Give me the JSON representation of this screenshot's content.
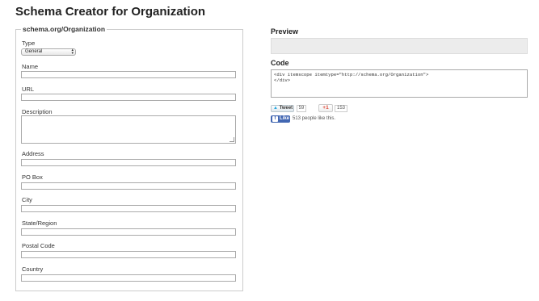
{
  "header": {
    "title": "Schema Creator for Organization"
  },
  "form": {
    "legend": "schema.org/Organization",
    "type_label": "Type",
    "type_value": "General",
    "fields": [
      {
        "label": "Name"
      },
      {
        "label": "URL"
      },
      {
        "label": "Description"
      },
      {
        "label": "Address"
      },
      {
        "label": "PO Box"
      },
      {
        "label": "City"
      },
      {
        "label": "State/Region"
      },
      {
        "label": "Postal Code"
      },
      {
        "label": "Country"
      }
    ]
  },
  "preview": {
    "title": "Preview"
  },
  "code": {
    "title": "Code",
    "content": "<div itemscope itemtype=\"http://schema.org/Organization\">\n</div>"
  },
  "social": {
    "tweet_label": "Tweet",
    "tweet_count": "59",
    "gplus_label": "+1",
    "gplus_count": "153",
    "fb_label": "Like",
    "fb_text": "513 people like this."
  }
}
